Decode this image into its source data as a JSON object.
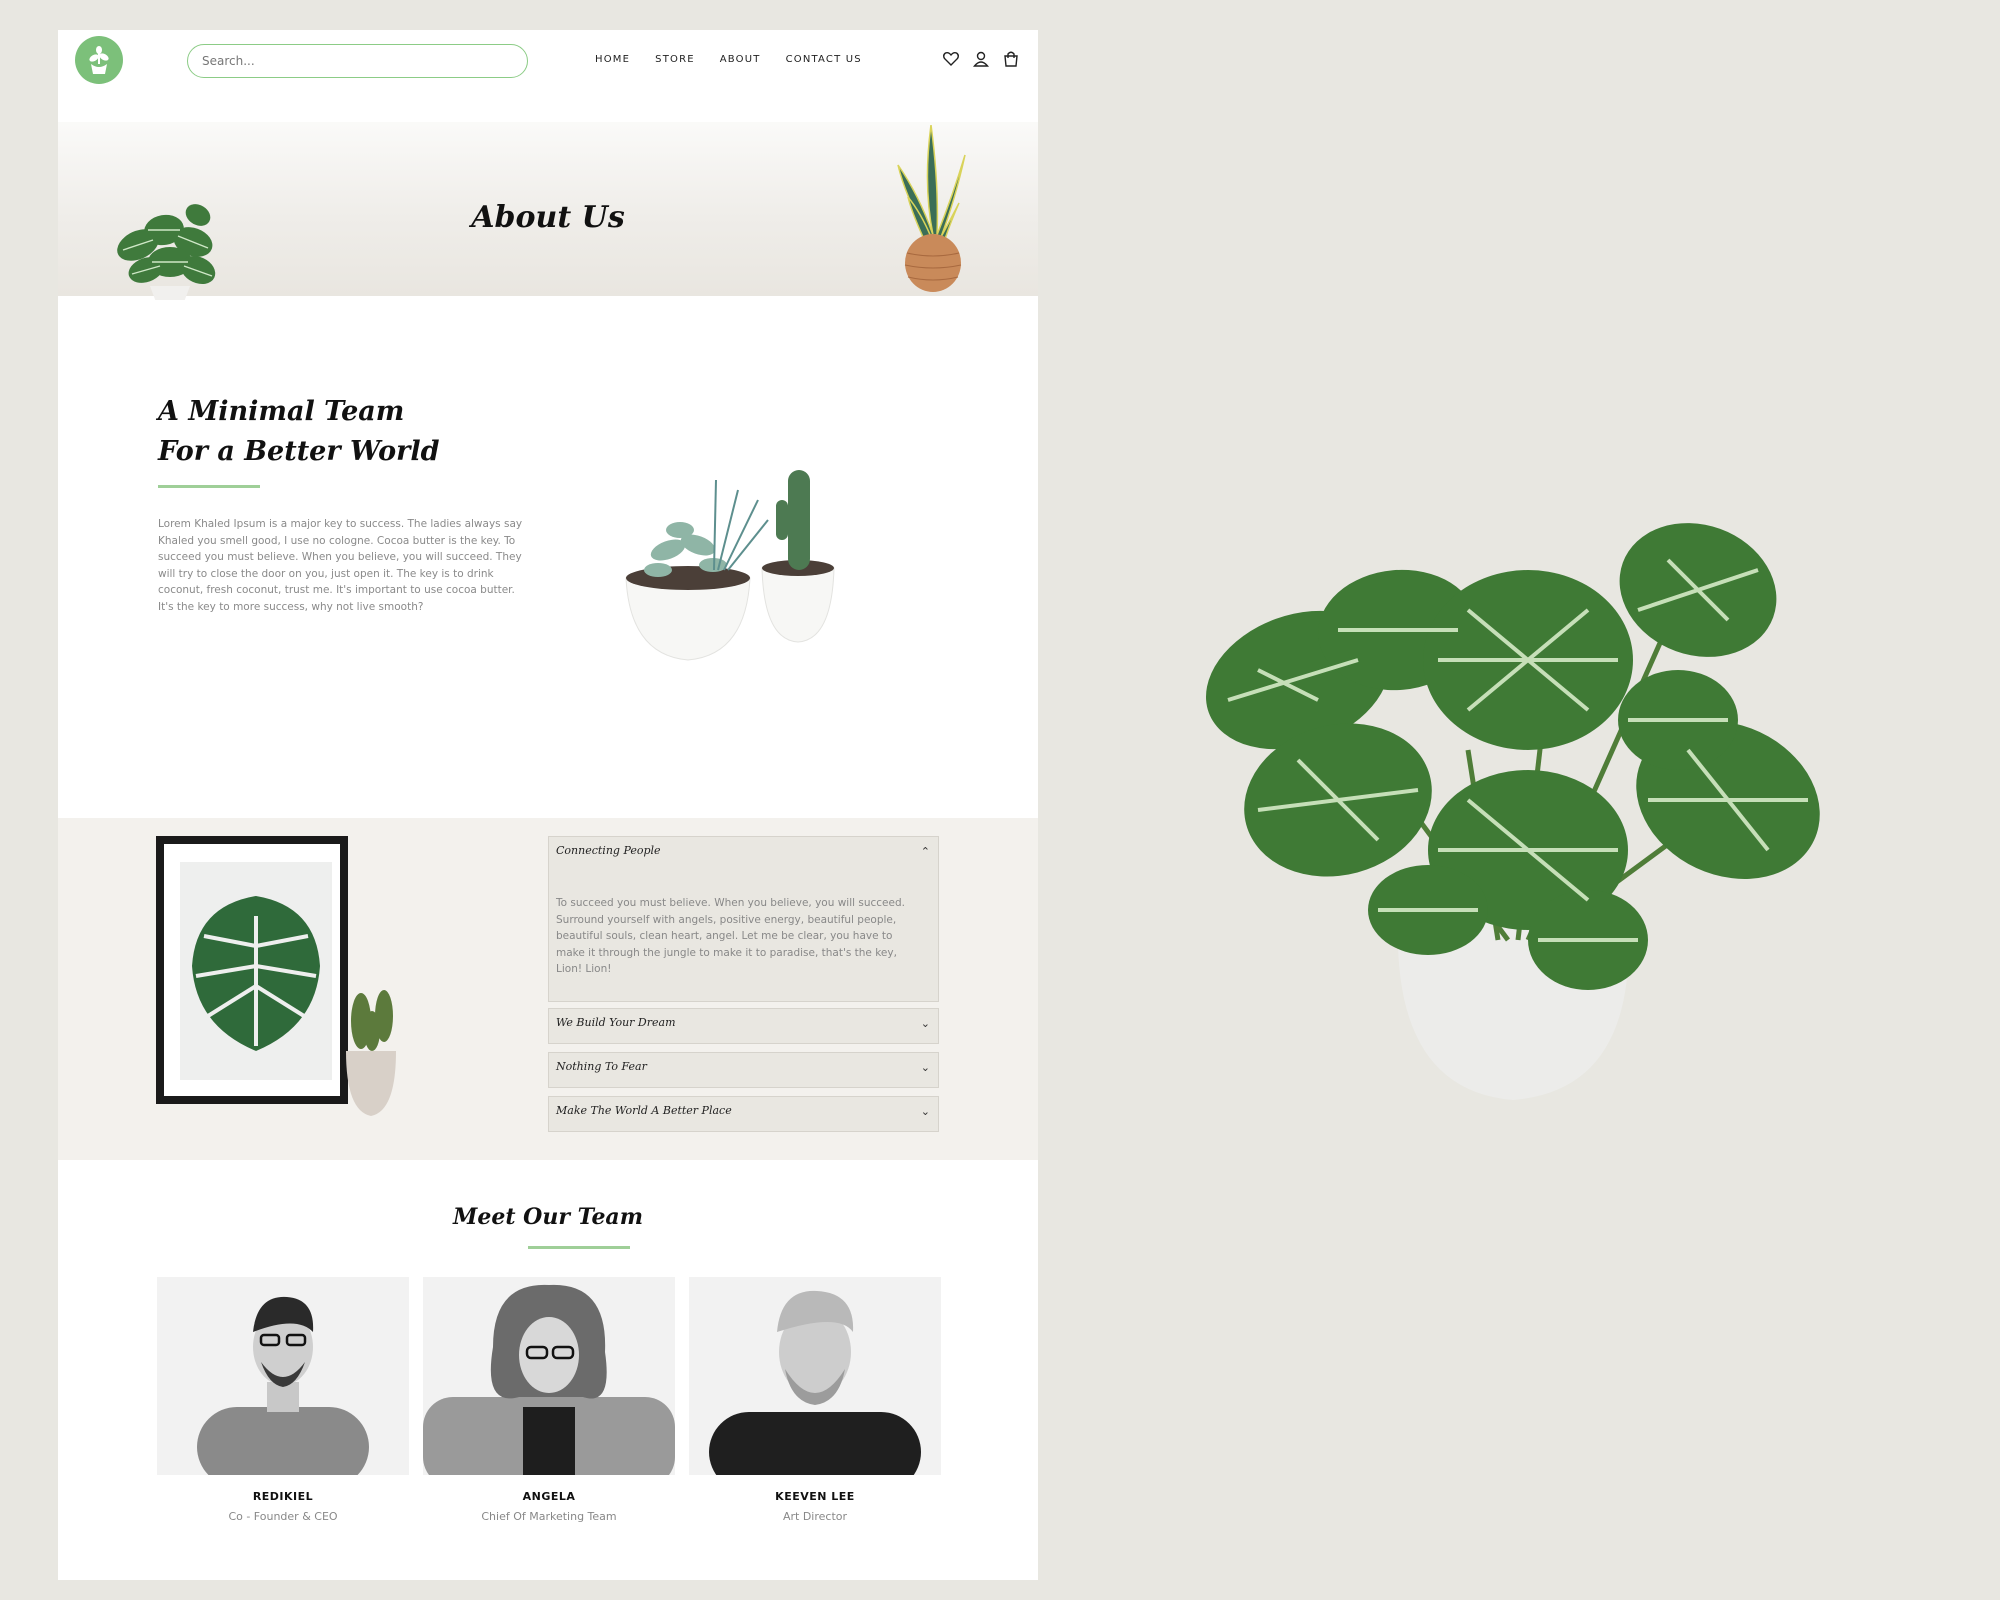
{
  "header": {
    "search_placeholder": "Search...",
    "nav": [
      "HOME",
      "STORE",
      "ABOUT",
      "CONTACT US"
    ],
    "icons": [
      "heart-icon",
      "user-icon",
      "cart-icon"
    ]
  },
  "hero": {
    "title": "About Us"
  },
  "intro": {
    "title_line1": "A Minimal Team",
    "title_line2": "For a Better World",
    "body": "Lorem Khaled Ipsum is a major key to success. The ladies always say Khaled you smell good, I use no cologne. Cocoa butter is the key. To succeed you must believe. When you believe, you will succeed. They will try to close the door on you, just open it. The key is to drink coconut, fresh coconut, trust me. It's important to use cocoa butter. It's the key to more success, why not live smooth?"
  },
  "accordion": [
    {
      "title": "Connecting People",
      "expanded": true,
      "body": "To succeed you must believe. When you believe, you will succeed. Surround yourself with angels, positive energy, beautiful people, beautiful souls, clean heart, angel. Let me be clear, you have to make it through the jungle to make it to paradise, that's the key, Lion! Lion!"
    },
    {
      "title": "We Build Your Dream",
      "expanded": false
    },
    {
      "title": "Nothing To Fear",
      "expanded": false
    },
    {
      "title": "Make The World A Better Place",
      "expanded": false
    }
  ],
  "team": {
    "title": "Meet Our Team",
    "members": [
      {
        "name": "REDIKIEL",
        "role": "Co - Founder & CEO"
      },
      {
        "name": "ANGELA",
        "role": "Chief Of Marketing Team"
      },
      {
        "name": "KEEVEN LEE",
        "role": "Art Director"
      }
    ]
  },
  "colors": {
    "accent_green": "#7cc07a",
    "background": "#e8e7e1",
    "band": "#f3f1ed"
  }
}
